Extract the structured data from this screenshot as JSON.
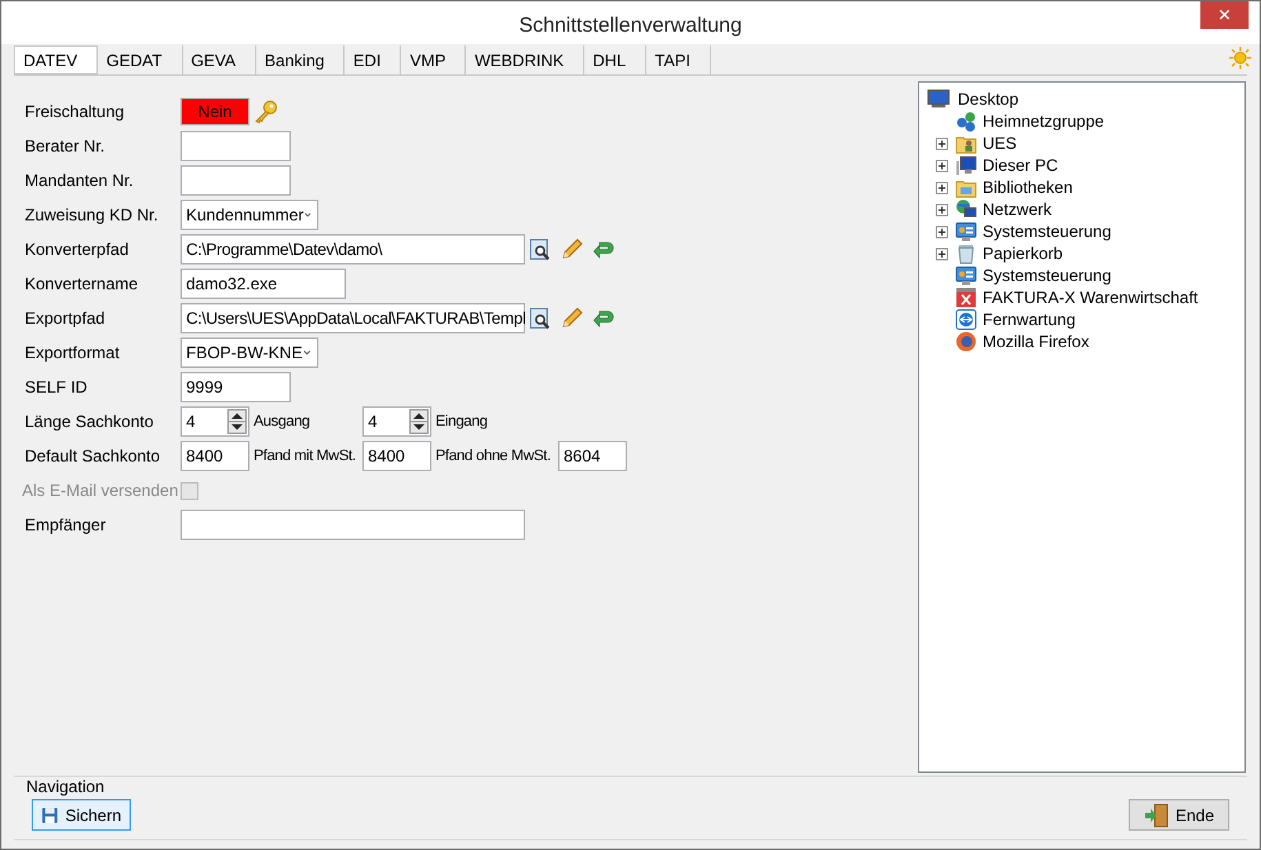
{
  "window": {
    "title": "Schnittstellenverwaltung",
    "close": "✕"
  },
  "tabs": [
    {
      "label": "DATEV",
      "selected": true
    },
    {
      "label": "GEDAT",
      "selected": false
    },
    {
      "label": "GEVA",
      "selected": false
    },
    {
      "label": "Banking",
      "selected": false
    },
    {
      "label": "EDI",
      "selected": false
    },
    {
      "label": "VMP",
      "selected": false
    },
    {
      "label": "WEBDRINK",
      "selected": false
    },
    {
      "label": "DHL",
      "selected": false
    },
    {
      "label": "TAPI",
      "selected": false
    }
  ],
  "form": [
    {
      "label": "Freischaltung",
      "kind": "status",
      "value": "Nein"
    },
    {
      "label": "Berater Nr.",
      "kind": "text"
    },
    {
      "label": "Mandanten Nr.",
      "kind": "text"
    },
    {
      "label": "Zuweisung KD Nr.",
      "kind": "select",
      "value": "Kundennummer"
    },
    {
      "label": "Konverterpfad",
      "kind": "path",
      "value": "C:\\Programme\\Datev\\damo\\"
    },
    {
      "label": "Konvertername",
      "kind": "wide",
      "value": "damo32.exe"
    },
    {
      "label": "Exportpfad",
      "kind": "path",
      "value": "C:\\Users\\UES\\AppData\\Local\\FAKTURAB\\Templ"
    },
    {
      "label": "Exportformat",
      "kind": "select",
      "value": "FBOP-BW-KNE"
    },
    {
      "label": "SELF ID",
      "kind": "text",
      "value": "9999"
    },
    {
      "label": "Länge Sachkonto",
      "kind": "group",
      "parts": [
        {
          "kind": "spin",
          "value": "4"
        },
        {
          "kind": "label",
          "text": "Ausgang"
        },
        {
          "kind": "spin",
          "value": "4"
        },
        {
          "kind": "label",
          "text": "Eingang"
        }
      ]
    },
    {
      "label": "Default Sachkonto",
      "kind": "group",
      "parts": [
        {
          "kind": "field",
          "value": "8400"
        },
        {
          "kind": "label",
          "text": "Pfand mit MwSt."
        },
        {
          "kind": "field",
          "value": "8400"
        },
        {
          "kind": "label",
          "text": "Pfand ohne MwSt."
        },
        {
          "kind": "field",
          "value": "8604"
        }
      ]
    },
    {
      "label": "Als E-Mail versenden",
      "kind": "checkbox",
      "checked": false,
      "disabled": true
    },
    {
      "label": "Empfänger",
      "kind": "path_plain"
    }
  ],
  "tree": {
    "label": "Desktop",
    "children": [
      {
        "label": "Heimnetzgruppe",
        "kind": "leaf"
      },
      {
        "label": "UES",
        "kind": "expandable"
      },
      {
        "label": "Dieser PC",
        "kind": "expandable"
      },
      {
        "label": "Bibliotheken",
        "kind": "expandable"
      },
      {
        "label": "Netzwerk",
        "kind": "expandable"
      },
      {
        "label": "Systemsteuerung",
        "kind": "expandable"
      },
      {
        "label": "Papierkorb",
        "kind": "expandable"
      },
      {
        "label": "Systemsteuerung",
        "kind": "leaf"
      },
      {
        "label": "FAKTURA-X Warenwirtschaft",
        "kind": "leaf"
      },
      {
        "label": "Fernwartung",
        "kind": "leaf"
      },
      {
        "label": "Mozilla Firefox",
        "kind": "leaf"
      }
    ]
  },
  "navigation": {
    "title": "Navigation",
    "buttons": [
      {
        "label": "Sichern",
        "kind": "save",
        "focused": true
      },
      {
        "label": "Ende",
        "kind": "exit",
        "focused": false
      }
    ]
  }
}
